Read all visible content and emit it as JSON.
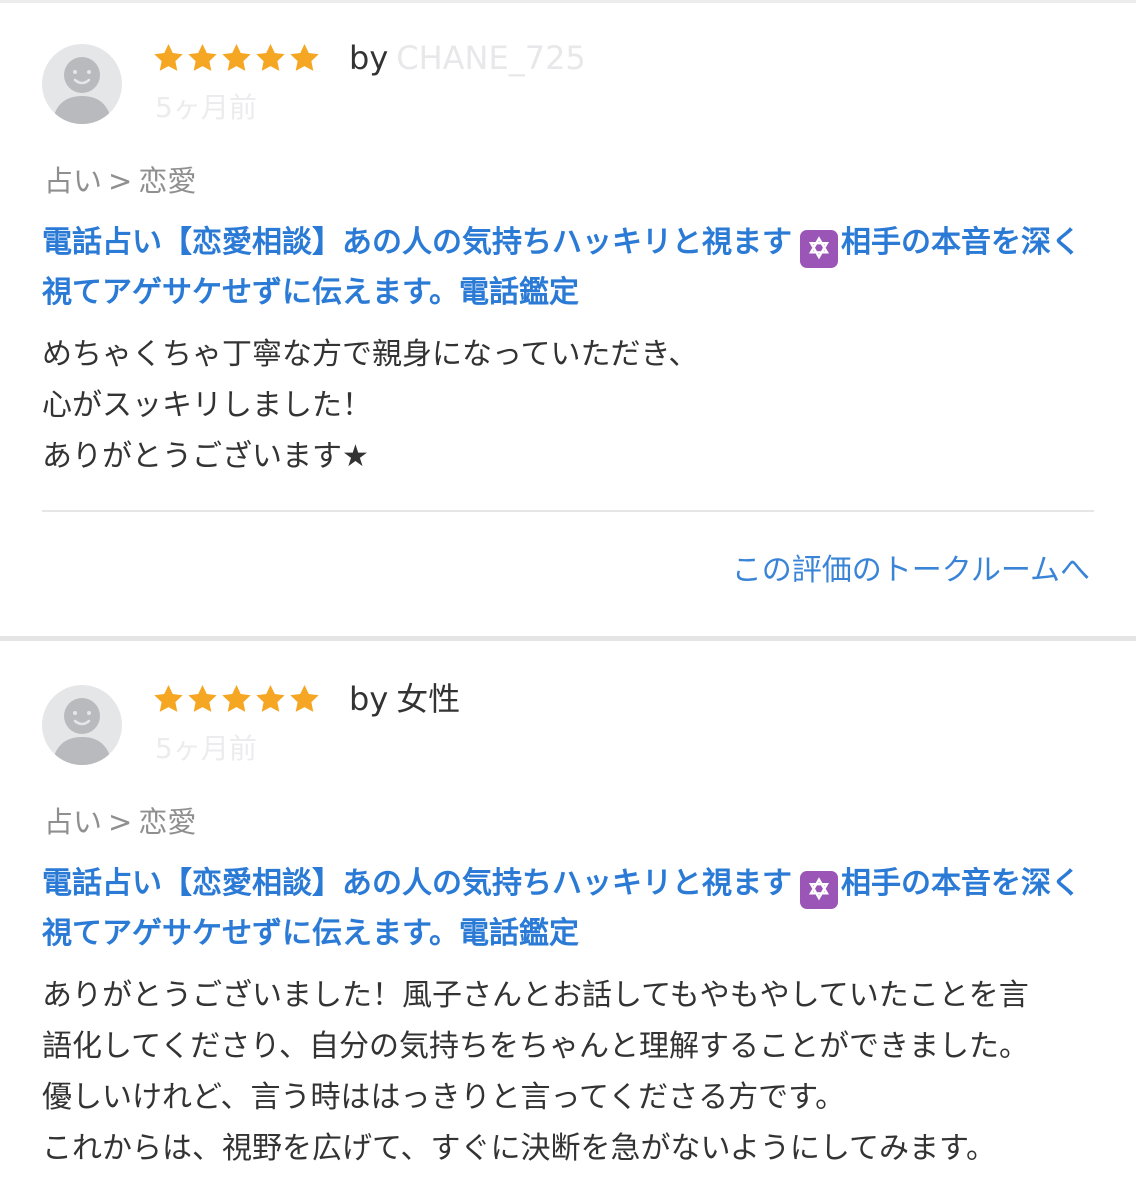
{
  "reviews": [
    {
      "rating": 5,
      "by_label": "by",
      "reviewer": "CHANE_725",
      "date": "5ヶ月前",
      "category": {
        "parent": "占い",
        "separator": ">",
        "child": "恋愛"
      },
      "service_title": {
        "part1": "電話占い【恋愛相談】あの人の気持ちハッキリと視ます",
        "emoji": "✡",
        "part2": "相手の本音を深く視てアゲサケせずに伝えます。電話鑑定"
      },
      "body_lines": [
        "めちゃくちゃ丁寧な方で親身になっていただき、",
        "心がスッキリしました！",
        "ありがとうございます★"
      ],
      "talkroom_link": "この評価のトークルームへ"
    },
    {
      "rating": 5,
      "by_label": "by",
      "reviewer": "女性",
      "date": "5ヶ月前",
      "category": {
        "parent": "占い",
        "separator": ">",
        "child": "恋愛"
      },
      "service_title": {
        "part1": "電話占い【恋愛相談】あの人の気持ちハッキリと視ます",
        "emoji": "✡",
        "part2": "相手の本音を深く視てアゲサケせずに伝えます。電話鑑定"
      },
      "body_lines": [
        "ありがとうございました！風子さんとお話してもやもやしていたことを言",
        "語化してくださり、自分の気持ちをちゃんと理解することができました。",
        "優しいけれど、言う時ははっきりと言ってくださる方です。",
        "これからは、視野を広げて、すぐに決断を急がないようにしてみます。"
      ]
    }
  ],
  "colors": {
    "star": "#f5a623",
    "link": "#2b7bd6",
    "category": "#8f8f8f",
    "avatar_bg": "#e5e6e8",
    "avatar_fg": "#b9babd",
    "emoji_bg": "#9a55b7"
  },
  "icons": {
    "avatar": "default-user-icon",
    "star": "star-icon",
    "emoji": "star-of-david-emoji"
  }
}
